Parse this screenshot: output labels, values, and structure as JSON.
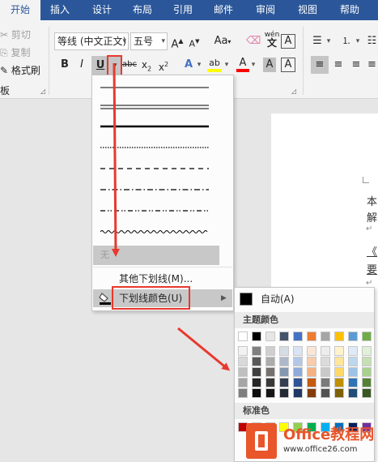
{
  "tabs": [
    "开始",
    "插入",
    "设计",
    "布局",
    "引用",
    "邮件",
    "审阅",
    "视图",
    "帮助"
  ],
  "clipboard": {
    "cut": "剪切",
    "copy": "复制",
    "format_painter": "格式刷",
    "group": "板"
  },
  "font": {
    "name": "等线 (中文正文)",
    "size": "五号"
  },
  "underline_menu": {
    "none_label": "无",
    "more_label": "其他下划线(M)...",
    "color_label": "下划线颜色(U)"
  },
  "color_submenu": {
    "auto_label": "自动(A)",
    "theme_label": "主题颜色",
    "standard_label": "标准色",
    "theme_colors": [
      [
        "#ffffff",
        "#f2f2f2",
        "#d9d9d9",
        "#bfbfbf",
        "#a6a6a6",
        "#7f7f7f"
      ],
      [
        "#000000",
        "#7f7f7f",
        "#595959",
        "#404040",
        "#262626",
        "#0d0d0d"
      ],
      [
        "#e7e6e6",
        "#d0cece",
        "#aeabab",
        "#757171",
        "#3b3838",
        "#171616"
      ],
      [
        "#44546a",
        "#d6dce5",
        "#adb9ca",
        "#8497b0",
        "#333f50",
        "#222a35"
      ],
      [
        "#4472c4",
        "#dae3f3",
        "#b4c7e7",
        "#8faadc",
        "#2f5597",
        "#1f3864"
      ],
      [
        "#ed7d31",
        "#fbe5d6",
        "#f8cbad",
        "#f4b183",
        "#c55a11",
        "#843c0c"
      ],
      [
        "#a5a5a5",
        "#ededed",
        "#dbdbdb",
        "#c9c9c9",
        "#7b7b7b",
        "#525252"
      ],
      [
        "#ffc000",
        "#fff2cc",
        "#ffe699",
        "#ffd966",
        "#bf9000",
        "#7f6000"
      ],
      [
        "#5b9bd5",
        "#deebf7",
        "#bdd7ee",
        "#9dc3e6",
        "#2e75b6",
        "#1f4e79"
      ],
      [
        "#70ad47",
        "#e2f0d9",
        "#c5e0b4",
        "#a9d18e",
        "#548235",
        "#385723"
      ]
    ],
    "standard_colors": [
      "#c00000",
      "#ff0000",
      "#ffc000",
      "#ffff00",
      "#92d050",
      "#00b050",
      "#00b0f0",
      "#0070c0",
      "#002060",
      "#7030a0"
    ]
  },
  "page_text": {
    "line1": "本",
    "line2": "解",
    "line3": "《",
    "line4": "要"
  },
  "logo": {
    "name": "Office教程网",
    "url": "www.office26.com"
  },
  "colors": {
    "accent": "#2b579a",
    "annotation": "#e8392e"
  }
}
